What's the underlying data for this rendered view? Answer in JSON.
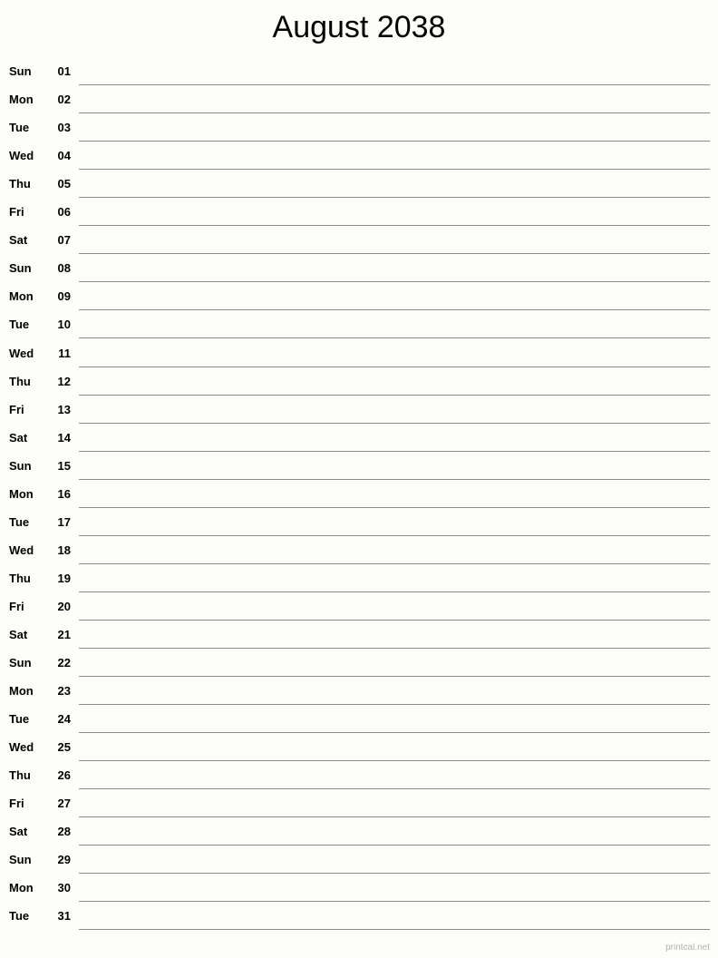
{
  "document": {
    "title": "August 2038",
    "month": "August",
    "year": "2038"
  },
  "footer": {
    "watermark": "printcal.net"
  },
  "colors": {
    "background": "#fdfdfa",
    "text": "#000000",
    "rule": "#8c8c8c",
    "watermark": "#b3b3b3"
  },
  "rows": [
    {
      "weekday": "Sun",
      "day": "01"
    },
    {
      "weekday": "Mon",
      "day": "02"
    },
    {
      "weekday": "Tue",
      "day": "03"
    },
    {
      "weekday": "Wed",
      "day": "04"
    },
    {
      "weekday": "Thu",
      "day": "05"
    },
    {
      "weekday": "Fri",
      "day": "06"
    },
    {
      "weekday": "Sat",
      "day": "07"
    },
    {
      "weekday": "Sun",
      "day": "08"
    },
    {
      "weekday": "Mon",
      "day": "09"
    },
    {
      "weekday": "Tue",
      "day": "10"
    },
    {
      "weekday": "Wed",
      "day": "11"
    },
    {
      "weekday": "Thu",
      "day": "12"
    },
    {
      "weekday": "Fri",
      "day": "13"
    },
    {
      "weekday": "Sat",
      "day": "14"
    },
    {
      "weekday": "Sun",
      "day": "15"
    },
    {
      "weekday": "Mon",
      "day": "16"
    },
    {
      "weekday": "Tue",
      "day": "17"
    },
    {
      "weekday": "Wed",
      "day": "18"
    },
    {
      "weekday": "Thu",
      "day": "19"
    },
    {
      "weekday": "Fri",
      "day": "20"
    },
    {
      "weekday": "Sat",
      "day": "21"
    },
    {
      "weekday": "Sun",
      "day": "22"
    },
    {
      "weekday": "Mon",
      "day": "23"
    },
    {
      "weekday": "Tue",
      "day": "24"
    },
    {
      "weekday": "Wed",
      "day": "25"
    },
    {
      "weekday": "Thu",
      "day": "26"
    },
    {
      "weekday": "Fri",
      "day": "27"
    },
    {
      "weekday": "Sat",
      "day": "28"
    },
    {
      "weekday": "Sun",
      "day": "29"
    },
    {
      "weekday": "Mon",
      "day": "30"
    },
    {
      "weekday": "Tue",
      "day": "31"
    }
  ]
}
